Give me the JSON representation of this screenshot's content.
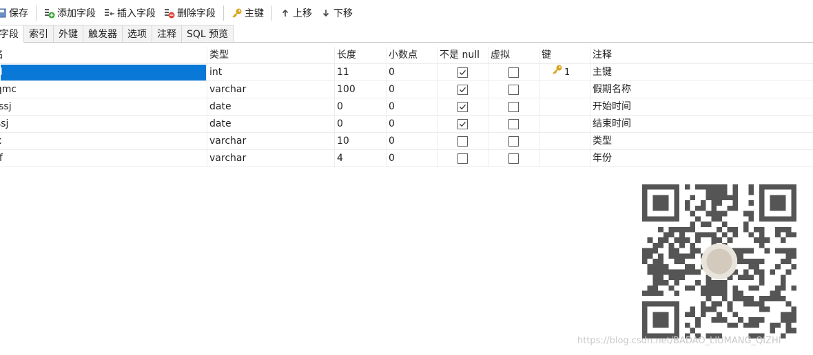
{
  "toolbar": {
    "save": "保存",
    "add_field": "添加字段",
    "insert_field": "插入字段",
    "delete_field": "删除字段",
    "primary_key": "主键",
    "move_up": "上移",
    "move_down": "下移"
  },
  "tabs": [
    "字段",
    "索引",
    "外键",
    "触发器",
    "选项",
    "注释",
    "SQL 预览"
  ],
  "columns": [
    "名",
    "类型",
    "长度",
    "小数点",
    "不是 null",
    "虚拟",
    "键",
    "注释"
  ],
  "rows": [
    {
      "name": "id",
      "type": "int",
      "length": "11",
      "decimals": "0",
      "not_null": true,
      "virtual": false,
      "key": "1",
      "comment": "主键"
    },
    {
      "name": "jqmc",
      "type": "varchar",
      "length": "100",
      "decimals": "0",
      "not_null": true,
      "virtual": false,
      "key": "",
      "comment": "假期名称"
    },
    {
      "name": "kssj",
      "type": "date",
      "length": "0",
      "decimals": "0",
      "not_null": true,
      "virtual": false,
      "key": "",
      "comment": "开始时间"
    },
    {
      "name": "jssj",
      "type": "date",
      "length": "0",
      "decimals": "0",
      "not_null": true,
      "virtual": false,
      "key": "",
      "comment": "结束时间"
    },
    {
      "name": "lx",
      "type": "varchar",
      "length": "10",
      "decimals": "0",
      "not_null": false,
      "virtual": false,
      "key": "",
      "comment": "类型"
    },
    {
      "name": "nf",
      "type": "varchar",
      "length": "4",
      "decimals": "0",
      "not_null": false,
      "virtual": false,
      "key": "",
      "comment": "年份"
    }
  ],
  "watermark": "https://blog.csdn.net/BADAO_LIUMANG_QIZHI",
  "colors": {
    "selection": "#0a78d7",
    "key_icon": "#d9a520"
  }
}
